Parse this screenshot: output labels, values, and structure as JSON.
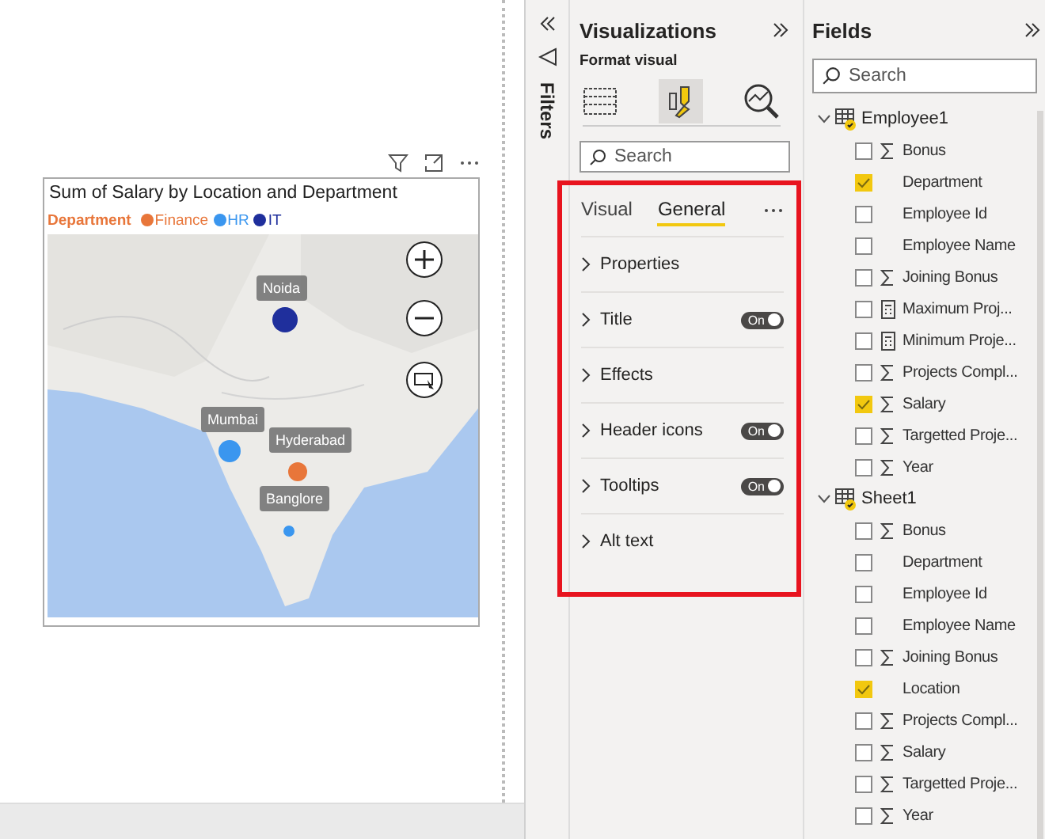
{
  "visual": {
    "title": "Sum of Salary by Location and Department",
    "legend": {
      "title": "Department",
      "items": [
        {
          "label": "Finance",
          "color": "#e8763a"
        },
        {
          "label": "HR",
          "color": "#3a96ef"
        },
        {
          "label": "IT",
          "color": "#1f2f9c"
        }
      ]
    },
    "map": {
      "kind": "picture",
      "bubbles": [
        {
          "label": "Noida",
          "color": "#1f2f9c"
        },
        {
          "label": "Mumbai",
          "color": "#3a96ef"
        },
        {
          "label": "Hyderabad",
          "color": "#e8763a"
        },
        {
          "label": "Banglore",
          "color": "#3a96ef"
        }
      ]
    }
  },
  "filters": {
    "label": "Filters"
  },
  "visualizations": {
    "title": "Visualizations",
    "subtitle": "Format visual",
    "search": {
      "placeholder": "Search"
    },
    "tabs": [
      {
        "label": "Visual",
        "selected": false
      },
      {
        "label": "General",
        "selected": true
      }
    ],
    "sections": [
      {
        "label": "Properties"
      },
      {
        "label": "Title",
        "toggle": {
          "label": "On",
          "on": true
        }
      },
      {
        "label": "Effects"
      },
      {
        "label": "Header icons",
        "toggle": {
          "label": "On",
          "on": true
        }
      },
      {
        "label": "Tooltips",
        "toggle": {
          "label": "On",
          "on": true
        }
      },
      {
        "label": "Alt text"
      }
    ]
  },
  "fields": {
    "title": "Fields",
    "search": {
      "placeholder": "Search"
    },
    "tables": [
      {
        "name": "Employee1",
        "expanded": true,
        "in_use": true,
        "fields": [
          {
            "name": "Bonus",
            "kind": "measure",
            "checked": false
          },
          {
            "name": "Department",
            "kind": "column",
            "checked": true
          },
          {
            "name": "Employee Id",
            "kind": "column",
            "checked": false
          },
          {
            "name": "Employee Name",
            "kind": "column",
            "checked": false
          },
          {
            "name": "Joining Bonus",
            "kind": "measure",
            "checked": false
          },
          {
            "name": "Maximum Proj...",
            "kind": "calc",
            "checked": false
          },
          {
            "name": "Minimum Proje...",
            "kind": "calc",
            "checked": false
          },
          {
            "name": "Projects Compl...",
            "kind": "measure",
            "checked": false
          },
          {
            "name": "Salary",
            "kind": "measure",
            "checked": true
          },
          {
            "name": "Targetted Proje...",
            "kind": "measure",
            "checked": false
          },
          {
            "name": "Year",
            "kind": "measure",
            "checked": false
          }
        ]
      },
      {
        "name": "Sheet1",
        "expanded": true,
        "in_use": true,
        "fields": [
          {
            "name": "Bonus",
            "kind": "measure",
            "checked": false
          },
          {
            "name": "Department",
            "kind": "column",
            "checked": false
          },
          {
            "name": "Employee Id",
            "kind": "column",
            "checked": false
          },
          {
            "name": "Employee Name",
            "kind": "column",
            "checked": false
          },
          {
            "name": "Joining Bonus",
            "kind": "measure",
            "checked": false
          },
          {
            "name": "Location",
            "kind": "column",
            "checked": true
          },
          {
            "name": "Projects Compl...",
            "kind": "measure",
            "checked": false
          },
          {
            "name": "Salary",
            "kind": "measure",
            "checked": false
          },
          {
            "name": "Targetted Proje...",
            "kind": "measure",
            "checked": false
          },
          {
            "name": "Year",
            "kind": "measure",
            "checked": false
          }
        ]
      }
    ]
  }
}
